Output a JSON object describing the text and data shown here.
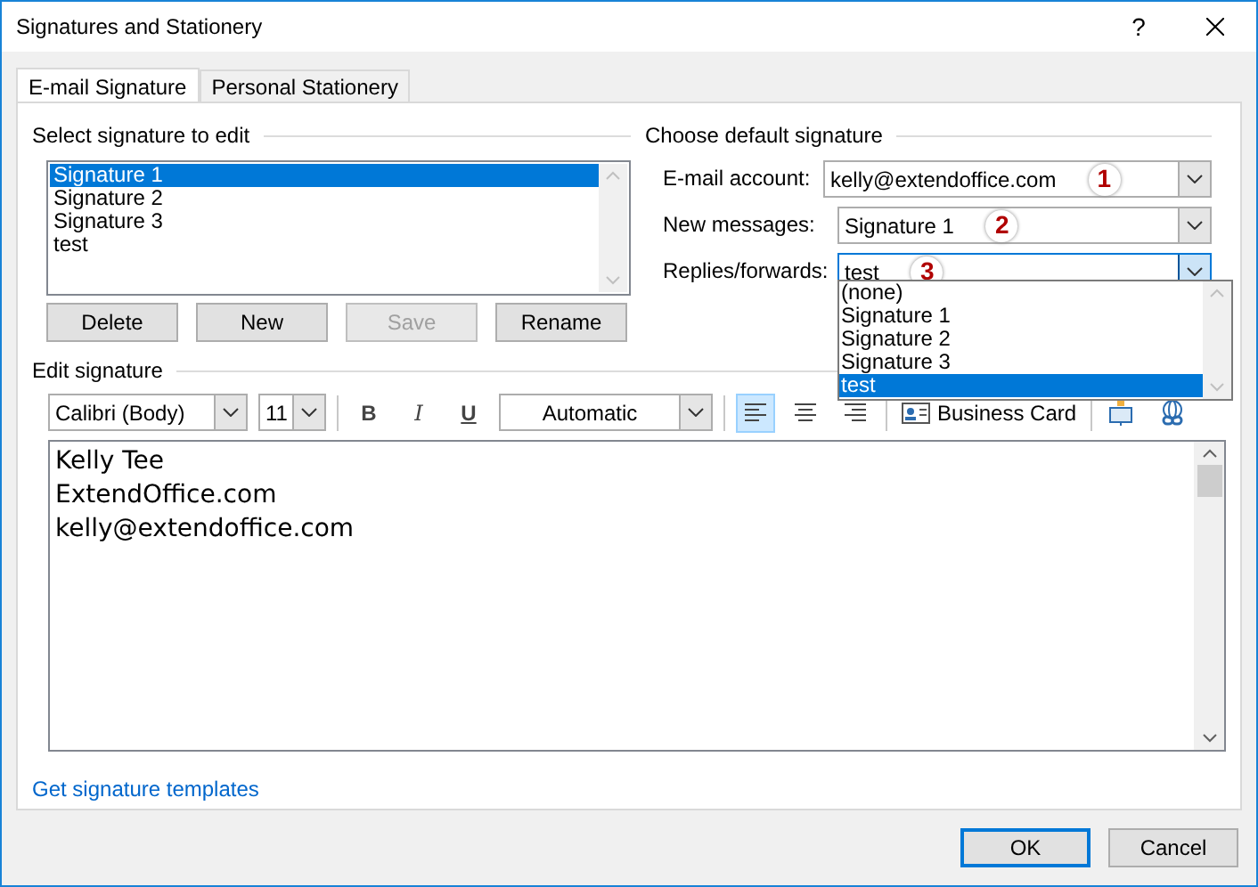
{
  "window": {
    "title": "Signatures and Stationery",
    "help": "?"
  },
  "tabs": [
    {
      "label": "E-mail Signature",
      "selected": true
    },
    {
      "label": "Personal Stationery",
      "selected": false
    }
  ],
  "select_section": {
    "title": "Select signature to edit",
    "items": [
      {
        "label": "Signature 1",
        "selected": true
      },
      {
        "label": "Signature 2",
        "selected": false
      },
      {
        "label": "Signature 3",
        "selected": false
      },
      {
        "label": "test",
        "selected": false
      }
    ],
    "buttons": [
      {
        "label": "Delete",
        "disabled": false
      },
      {
        "label": "New",
        "disabled": false
      },
      {
        "label": "Save",
        "disabled": true
      },
      {
        "label": "Rename",
        "disabled": false
      }
    ]
  },
  "default_section": {
    "title": "Choose default signature",
    "fields": [
      {
        "label": "E-mail account:",
        "value": "kelly@extendoffice.com",
        "badge": "1",
        "open": false
      },
      {
        "label": "New messages:",
        "value": "Signature 1",
        "badge": "2",
        "open": false
      },
      {
        "label": "Replies/forwards:",
        "value": "test",
        "badge": "3",
        "open": true
      }
    ],
    "dropdown": [
      {
        "label": "(none)",
        "selected": false
      },
      {
        "label": "Signature 1",
        "selected": false
      },
      {
        "label": "Signature 2",
        "selected": false
      },
      {
        "label": "Signature 3",
        "selected": false
      },
      {
        "label": "test",
        "selected": true
      }
    ]
  },
  "edit_section": {
    "title": "Edit signature",
    "font": "Calibri (Body)",
    "size": "11",
    "bold": "B",
    "italic": "I",
    "underline": "U",
    "font_color": "Automatic",
    "align": [
      {
        "kind": "left",
        "selected": true
      },
      {
        "kind": "center",
        "selected": false
      },
      {
        "kind": "right",
        "selected": false
      }
    ],
    "business_card": "Business Card",
    "lines": [
      "Kelly Tee",
      "ExtendOffice.com",
      "kelly@extendoffice.com"
    ]
  },
  "link": "Get signature templates",
  "buttons": [
    "OK",
    "Cancel"
  ]
}
